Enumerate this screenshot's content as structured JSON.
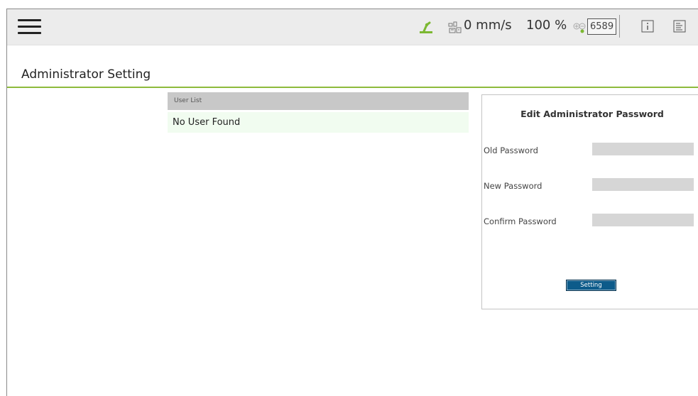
{
  "header": {
    "speed_value": "0 mm/s",
    "percentage": "100 %",
    "counter": "6589",
    "icons": [
      "menu-icon",
      "robot-arm-icon",
      "speed-icon",
      "io-icon",
      "info-icon",
      "log-icon"
    ],
    "accent_color": "#8dbb3c"
  },
  "page": {
    "title": "Administrator Setting"
  },
  "user_list": {
    "header": "User List",
    "empty_message": "No User Found"
  },
  "password_panel": {
    "title": "Edit Administrator Password",
    "fields": [
      {
        "label": "Old Password",
        "value": ""
      },
      {
        "label": "New Password",
        "value": ""
      },
      {
        "label": "Confirm Password",
        "value": ""
      }
    ],
    "button_label": "Setting",
    "button_color": "#0d5b8a"
  }
}
